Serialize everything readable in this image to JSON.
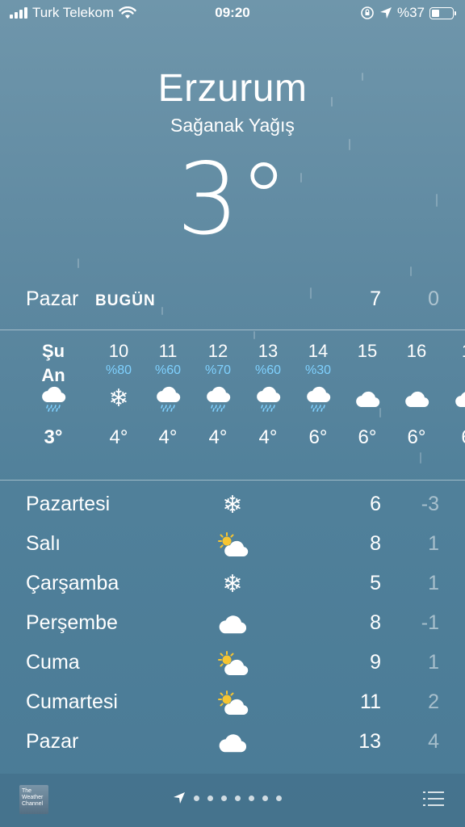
{
  "status_bar": {
    "carrier": "Turk Telekom",
    "time": "09:20",
    "battery": "%37",
    "battery_level": 0.37
  },
  "header": {
    "city": "Erzurum",
    "condition": "Sağanak Yağış",
    "temperature": "3°"
  },
  "today": {
    "day": "Pazar",
    "badge": "BUGÜN",
    "high": "7",
    "low": "0"
  },
  "hourly": [
    {
      "label": "Şu An",
      "precip": "",
      "icon": "rain-cloud-icon",
      "temp": "3°"
    },
    {
      "label": "10",
      "precip": "%80",
      "icon": "snowflake-icon",
      "temp": "4°"
    },
    {
      "label": "11",
      "precip": "%60",
      "icon": "rain-cloud-icon",
      "temp": "4°"
    },
    {
      "label": "12",
      "precip": "%70",
      "icon": "rain-cloud-icon",
      "temp": "4°"
    },
    {
      "label": "13",
      "precip": "%60",
      "icon": "rain-cloud-icon",
      "temp": "4°"
    },
    {
      "label": "14",
      "precip": "%30",
      "icon": "rain-cloud-icon",
      "temp": "6°"
    },
    {
      "label": "15",
      "precip": "",
      "icon": "cloud-icon",
      "temp": "6°"
    },
    {
      "label": "16",
      "precip": "",
      "icon": "cloud-icon",
      "temp": "6°"
    },
    {
      "label": "1",
      "precip": "",
      "icon": "cloud-icon",
      "temp": "6"
    }
  ],
  "daily": [
    {
      "day": "Pazartesi",
      "icon": "snowflake-icon",
      "high": "6",
      "low": "-3"
    },
    {
      "day": "Salı",
      "icon": "partly-sunny-icon",
      "high": "8",
      "low": "1"
    },
    {
      "day": "Çarşamba",
      "icon": "snowflake-icon",
      "high": "5",
      "low": "1"
    },
    {
      "day": "Perşembe",
      "icon": "cloud-icon",
      "high": "8",
      "low": "-1"
    },
    {
      "day": "Cuma",
      "icon": "partly-sunny-icon",
      "high": "9",
      "low": "1"
    },
    {
      "day": "Cumartesi",
      "icon": "partly-sunny-icon",
      "high": "11",
      "low": "2"
    },
    {
      "day": "Pazar",
      "icon": "cloud-icon",
      "high": "13",
      "low": "4"
    }
  ],
  "bottom_bar": {
    "logo_text": "The Weather Channel",
    "page_count": 7
  },
  "colors": {
    "precip": "#7fd1ff",
    "sun": "#f7c531",
    "background_top": "#6f96ab",
    "background_bottom": "#4a7b96"
  }
}
